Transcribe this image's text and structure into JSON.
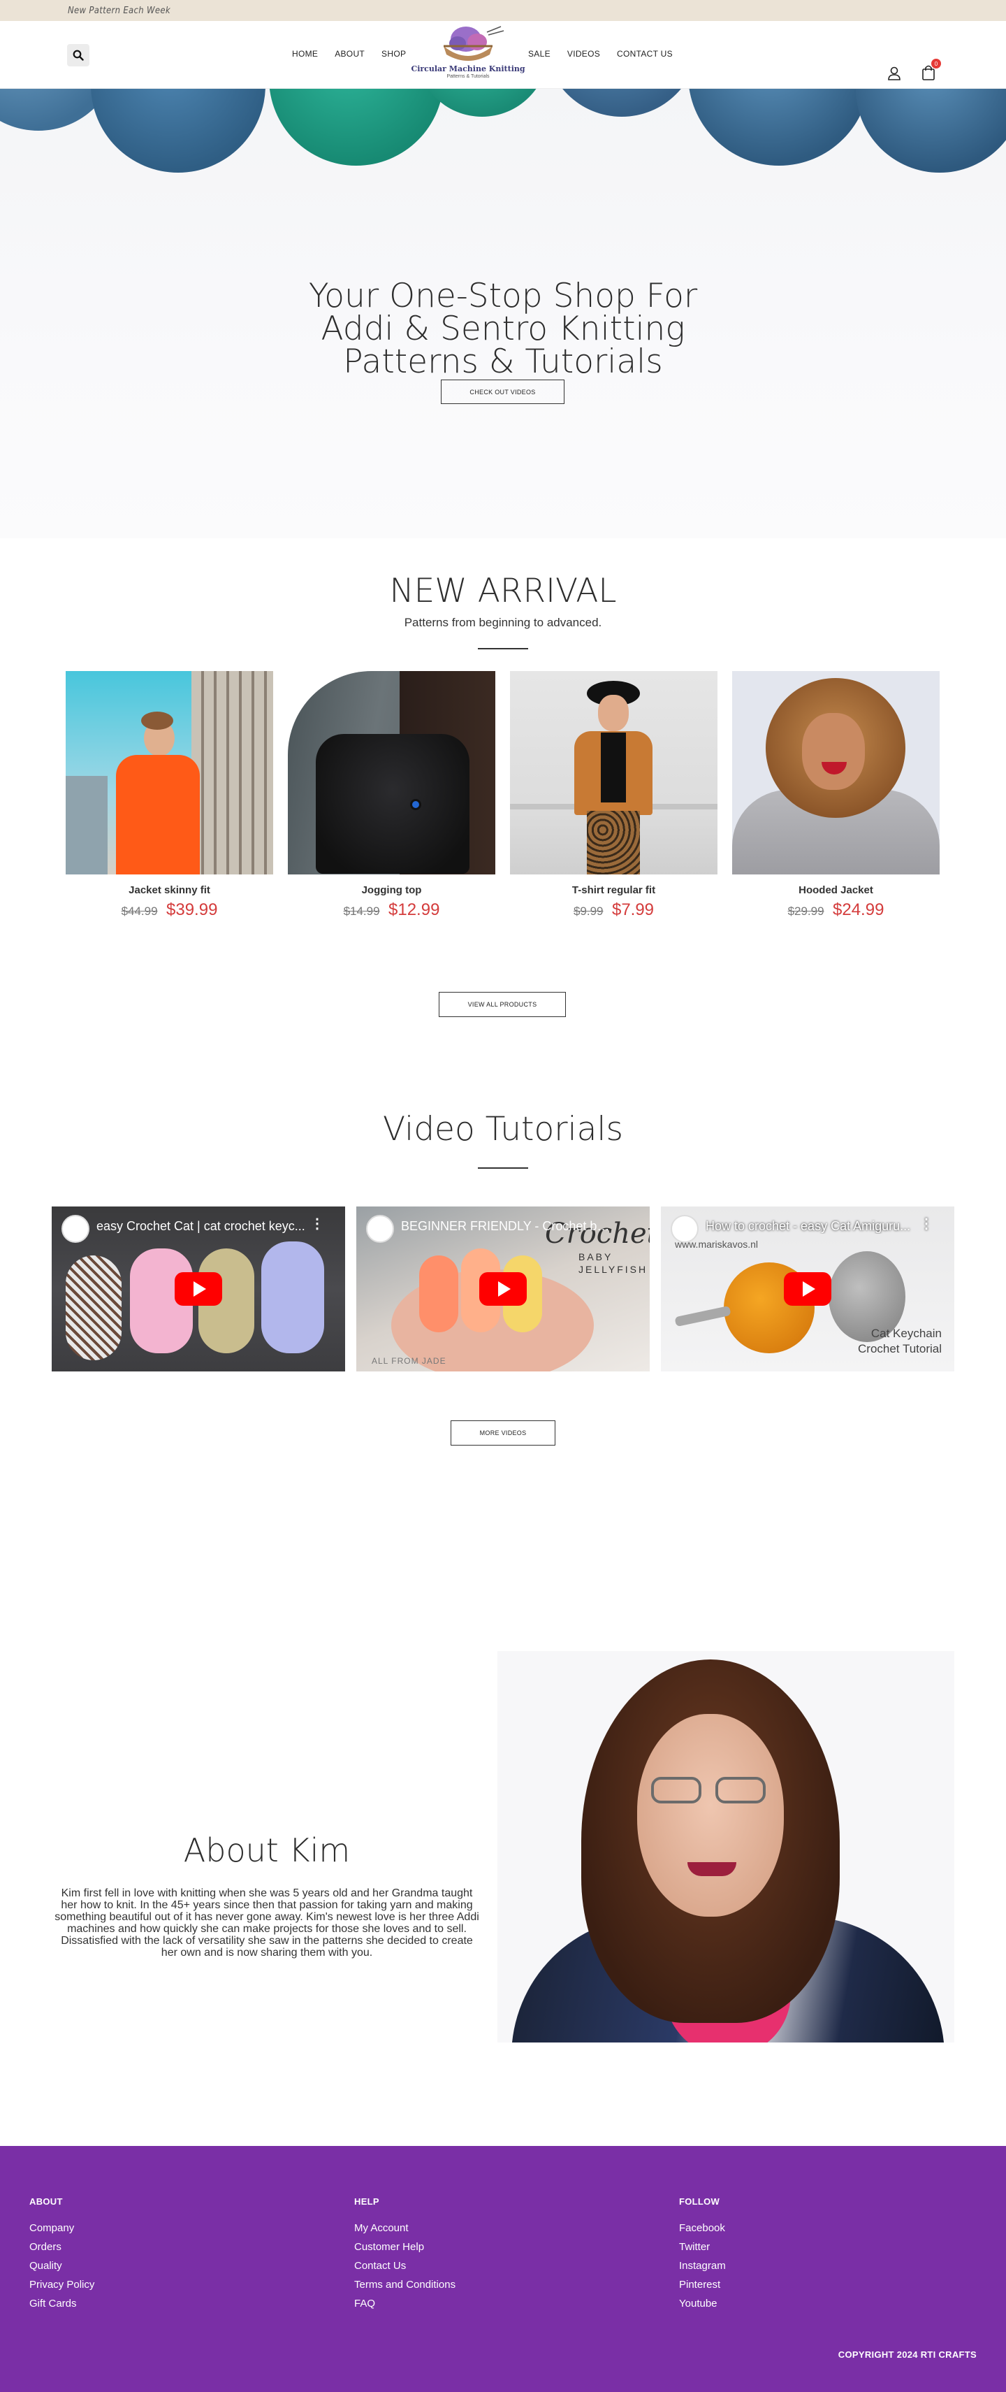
{
  "topbar": {
    "announcement": "New Pattern Each Week"
  },
  "header": {
    "nav_left": [
      "HOME",
      "ABOUT",
      "SHOP"
    ],
    "nav_right": [
      "SALE",
      "VIDEOS",
      "CONTACT US"
    ],
    "logo_title": "Circular Machine Knitting",
    "logo_subtitle": "Patterns & Tutorials",
    "cart_count": "0",
    "icons": {
      "search": "search-icon",
      "user": "user-icon",
      "cart": "shopping-bag-icon"
    }
  },
  "hero": {
    "title_lines": [
      "Your One-Stop Shop For",
      "Addi & Sentro Knitting",
      "Patterns & Tutorials"
    ],
    "button": "CHECK OUT VIDEOS"
  },
  "new_arrival": {
    "title": "NEW ARRIVAL",
    "subtitle": "Patterns from beginning to advanced.",
    "products": [
      {
        "name": "Jacket skinny fit",
        "old_price": "$44.99",
        "price": "$39.99"
      },
      {
        "name": "Jogging top",
        "old_price": "$14.99",
        "price": "$12.99"
      },
      {
        "name": "T-shirt regular fit",
        "old_price": "$9.99",
        "price": "$7.99"
      },
      {
        "name": "Hooded Jacket",
        "old_price": "$29.99",
        "price": "$24.99"
      }
    ],
    "button": "VIEW ALL PRODUCTS"
  },
  "videos": {
    "title": "Video Tutorials",
    "items": [
      {
        "title": "easy Crochet Cat | cat crochet keyc...",
        "overlay": ""
      },
      {
        "title": "BEGINNER FRIENDLY - Crochet bab...",
        "overlay": "Crochet",
        "overlay2": "BABY",
        "overlay3": "JELLYFISH",
        "overlay4": "ALL FROM JADE"
      },
      {
        "title": "How to crochet - easy Cat Amiguru...",
        "overlay": "www.mariskavos.nl",
        "overlay2": "Cat Keychain",
        "overlay3": "Crochet Tutorial"
      }
    ],
    "button": "MORE VIDEOS"
  },
  "about": {
    "title": "About Kim",
    "text": "Kim first fell in love with knitting when she was 5 years old and her Grandma taught her how to knit. In the 45+ years since then that passion for taking yarn and making something beautiful out of it has never gone away. Kim's newest love is her three Addi machines and how quickly she can make projects for those she loves and to sell. Dissatisfied with the lack of versatility she saw in the patterns she decided to create her own and is now sharing them with you."
  },
  "footer": {
    "about": {
      "heading": "ABOUT",
      "links": [
        "Company",
        "Orders",
        "Quality",
        "Privacy Policy",
        "Gift Cards"
      ]
    },
    "help": {
      "heading": "HELP",
      "links": [
        "My Account",
        "Customer Help",
        "Contact Us",
        "Terms and Conditions",
        "FAQ"
      ]
    },
    "follow": {
      "heading": "FOLLOW",
      "links": [
        "Facebook",
        "Twitter",
        "Instagram",
        "Pinterest",
        "Youtube"
      ]
    },
    "copyright": "COPYRIGHT 2024 RTI CRAFTS"
  },
  "colors": {
    "topbar": "#ebe3d6",
    "footer": "#7a2fa6",
    "sale_price": "#d43c3c",
    "youtube_red": "#ff0000"
  }
}
